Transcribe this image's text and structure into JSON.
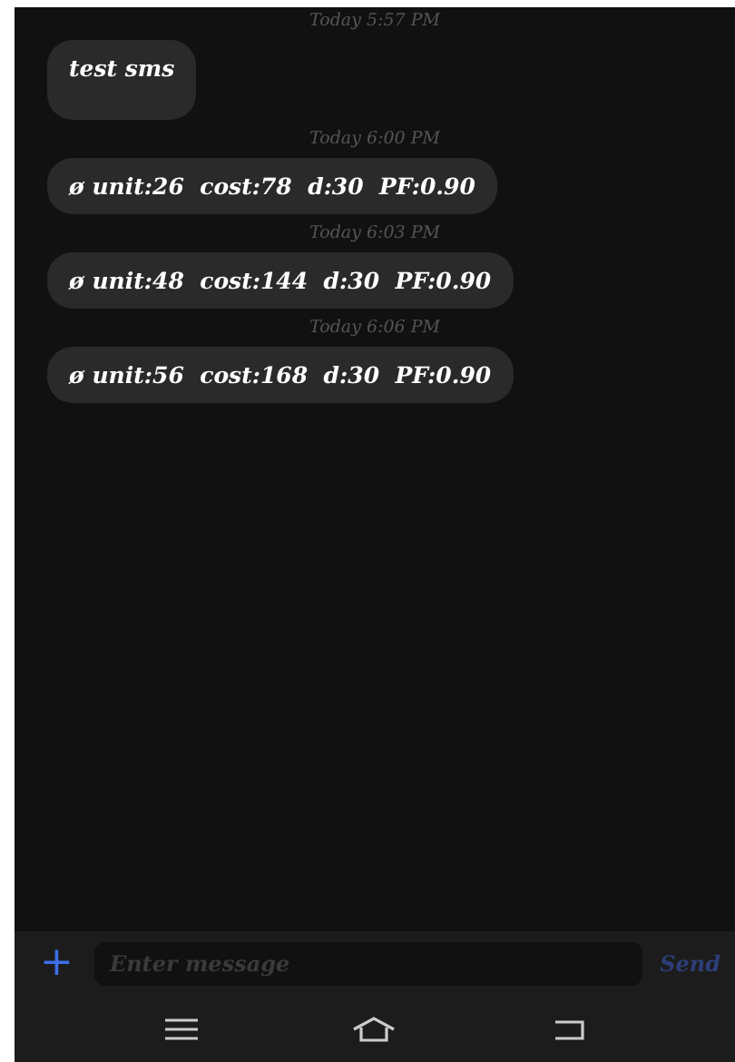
{
  "messages": [
    {
      "time": "Today 5:57 PM",
      "text": "test sms",
      "tall": true
    },
    {
      "time": "Today 6:00 PM",
      "text": "ø unit:26  cost:78  d:30  PF:0.90",
      "tall": false
    },
    {
      "time": "Today 6:03 PM",
      "text": "ø unit:48  cost:144  d:30  PF:0.90",
      "tall": false
    },
    {
      "time": "Today 6:06 PM",
      "text": "ø unit:56  cost:168  d:30  PF:0.90",
      "tall": false
    }
  ],
  "composer": {
    "attach": "+",
    "placeholder": "Enter message",
    "send": "Send"
  }
}
